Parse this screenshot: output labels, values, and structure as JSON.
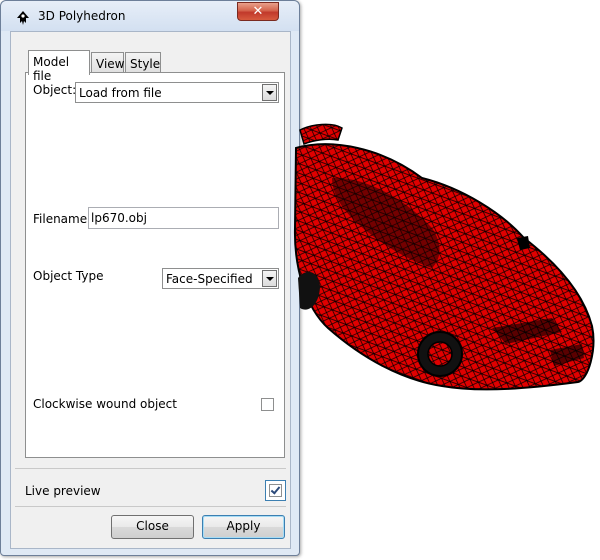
{
  "window": {
    "title": "3D Polyhedron",
    "close_glyph": "✕",
    "app_icon": "inkscape-logo-icon"
  },
  "tabs": [
    {
      "label": "Model file",
      "active": true
    },
    {
      "label": "View",
      "active": false
    },
    {
      "label": "Style",
      "active": false
    }
  ],
  "model_file": {
    "object_label": "Object:",
    "object_value": "Load from file",
    "filename_label": "Filename:",
    "filename_value": "lp670.obj",
    "object_type_label": "Object Type",
    "object_type_value": "Face-Specified",
    "clockwise_label": "Clockwise wound object",
    "clockwise_checked": false
  },
  "footer": {
    "live_preview_label": "Live preview",
    "live_preview_checked": true,
    "close_label": "Close",
    "apply_label": "Apply"
  },
  "preview": {
    "subject": "car-wireframe-mesh",
    "fill_color": "#e00000",
    "edge_color": "#000000"
  }
}
